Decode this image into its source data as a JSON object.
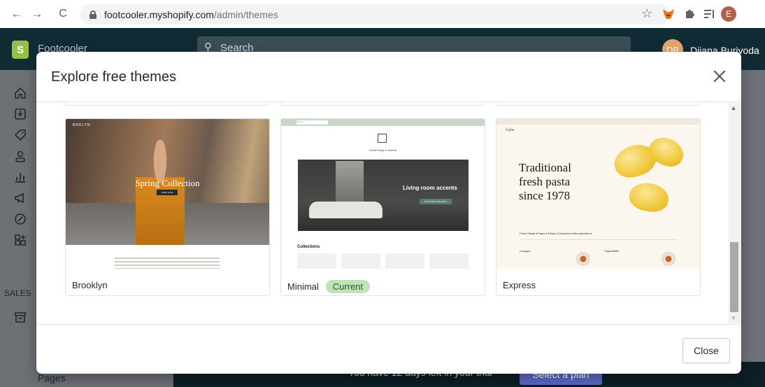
{
  "browser": {
    "url_host": "footcooler.myshopify.com",
    "url_path": "/admin/themes",
    "profile_initial": "E"
  },
  "admin": {
    "store_name": "Footcooler",
    "search_placeholder": "Search",
    "user_initials": "DB",
    "user_name": "Dijana Burivoda",
    "sidebar_section": "SALES",
    "sidebar_pages": "Pages",
    "trial_text": "You have 12 days left in your trial",
    "plan_button": "Select a plan"
  },
  "modal": {
    "title": "Explore free themes",
    "close_button": "Close",
    "themes": [
      {
        "name": "Brooklyn",
        "preview": {
          "nav": "BRKLYN",
          "hero_title": "Spring Collection",
          "hero_button": "SHOP NOW"
        }
      },
      {
        "name": "Minimal",
        "badge": "Current",
        "preview": {
          "search": "Search",
          "links": "Home   Shop ▾   Journal",
          "hero_title": "Living room accents",
          "hero_button": "SHOP BEST SELLERS",
          "section": "Collections"
        }
      },
      {
        "name": "Express",
        "preview": {
          "logo": "Giallo",
          "hero_title_1": "Traditional",
          "hero_title_2": "fresh pasta",
          "hero_title_3": "since 1978",
          "tabs": "Fresh Meals ▾     Pasta ▾     Drinks & Desserts ▾     Merchandise ▾",
          "item_1": "Lasagna",
          "item_2": "Pappardelle"
        }
      }
    ]
  },
  "colors": {
    "admin_topbar": "#112b35",
    "badge_bg": "#bbe5b3",
    "shopify_green": "#95bf47"
  }
}
